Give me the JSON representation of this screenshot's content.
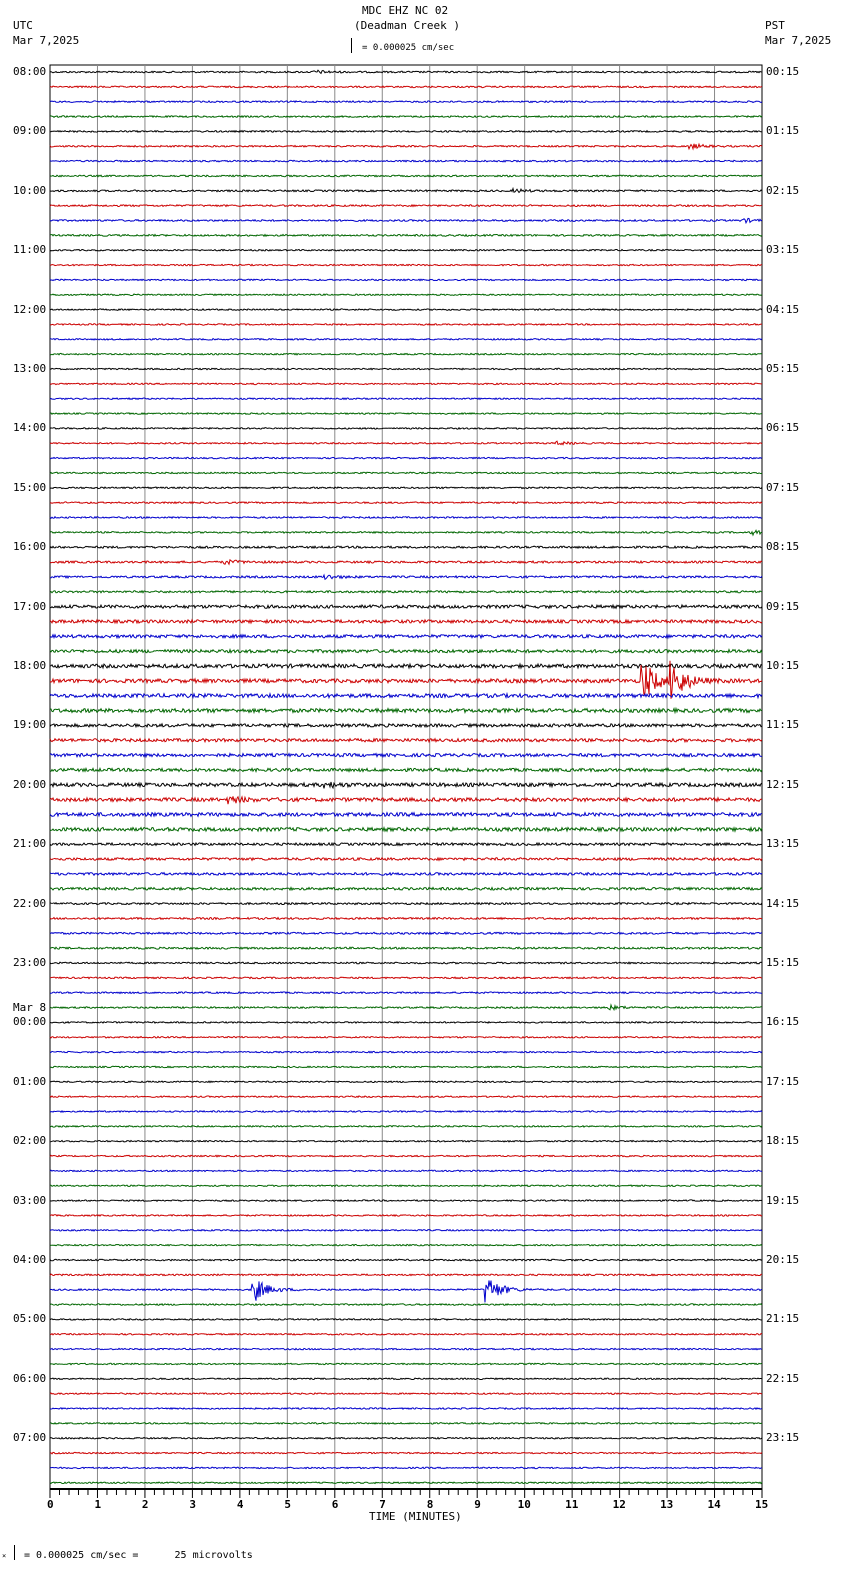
{
  "header": {
    "title": "MDC EHZ NC 02",
    "subtitle": "(Deadman Creek )",
    "scale": "= 0.000025 cm/sec",
    "left_tz": "UTC",
    "left_date": "Mar 7,2025",
    "right_tz": "PST",
    "right_date": "Mar 7,2025"
  },
  "footer": {
    "scale_note": "= 0.000025 cm/sec =      25 microvolts"
  },
  "chart_data": {
    "type": "line",
    "title": "MDC EHZ NC 02 (Deadman Creek )",
    "xlabel": "TIME (MINUTES)",
    "xlim": [
      0,
      15
    ],
    "x_ticks": [
      "0",
      "1",
      "2",
      "3",
      "4",
      "5",
      "6",
      "7",
      "8",
      "9",
      "10",
      "11",
      "12",
      "13",
      "14",
      "15"
    ],
    "rows_per_hour": 4,
    "trace_colors": [
      "#000000",
      "#cc0000",
      "#0000cc",
      "#006600"
    ],
    "utc_labels": [
      "08:00",
      "09:00",
      "10:00",
      "11:00",
      "12:00",
      "13:00",
      "14:00",
      "15:00",
      "16:00",
      "17:00",
      "18:00",
      "19:00",
      "20:00",
      "21:00",
      "22:00",
      "23:00",
      "00:00",
      "01:00",
      "02:00",
      "03:00",
      "04:00",
      "05:00",
      "06:00",
      "07:00"
    ],
    "date_change_label": "Mar 8",
    "pst_labels": [
      "00:15",
      "01:15",
      "02:15",
      "03:15",
      "04:15",
      "05:15",
      "06:15",
      "07:15",
      "08:15",
      "09:15",
      "10:15",
      "11:15",
      "12:15",
      "13:15",
      "14:15",
      "15:15",
      "16:15",
      "17:15",
      "18:15",
      "19:15",
      "20:15",
      "21:15",
      "22:15",
      "23:15"
    ],
    "hourly_noise_level": [
      1.0,
      1.0,
      1.1,
      0.9,
      0.9,
      0.9,
      0.9,
      1.0,
      1.3,
      2.0,
      2.4,
      2.0,
      2.3,
      1.6,
      1.2,
      1.0,
      0.9,
      0.9,
      0.9,
      0.9,
      1.0,
      0.9,
      0.9,
      0.9
    ],
    "events": [
      {
        "row": 0,
        "minute": 5.6,
        "amp": 3
      },
      {
        "row": 5,
        "minute": 13.5,
        "amp": 5
      },
      {
        "row": 8,
        "minute": 9.8,
        "amp": 3
      },
      {
        "row": 10,
        "minute": 14.6,
        "amp": 4
      },
      {
        "row": 25,
        "minute": 10.7,
        "amp": 3
      },
      {
        "row": 31,
        "minute": 14.8,
        "amp": 4
      },
      {
        "row": 33,
        "minute": 3.7,
        "amp": 4
      },
      {
        "row": 34,
        "minute": 5.8,
        "amp": 4
      },
      {
        "row": 41,
        "minute": 12.5,
        "amp": 40
      },
      {
        "row": 41,
        "minute": 13.1,
        "amp": 40
      },
      {
        "row": 49,
        "minute": 3.8,
        "amp": 6
      },
      {
        "row": 48,
        "minute": 5.8,
        "amp": 5
      },
      {
        "row": 63,
        "minute": 11.8,
        "amp": 4
      },
      {
        "row": 82,
        "minute": 4.3,
        "amp": 25
      },
      {
        "row": 82,
        "minute": 9.2,
        "amp": 30
      }
    ]
  }
}
